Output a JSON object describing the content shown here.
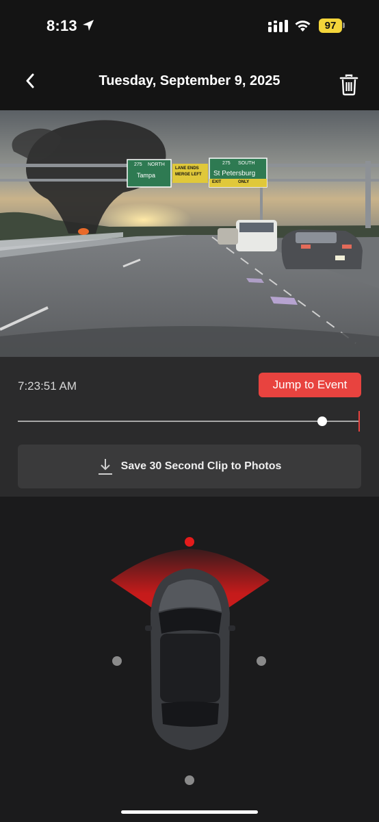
{
  "status_bar": {
    "time": "8:13",
    "battery": "97",
    "icons": [
      "location-arrow-icon",
      "cellular-signal-icon",
      "wifi-icon",
      "battery-icon"
    ]
  },
  "header": {
    "title": "Tuesday, September 9, 2025",
    "back_icon": "chevron-left-icon",
    "delete_icon": "trash-icon"
  },
  "video": {
    "signs": {
      "left_route": "275",
      "left_direction": "NORTH",
      "left_city": "Tampa",
      "middle_line1": "LANE ENDS",
      "middle_line2": "MERGE LEFT",
      "right_route": "275",
      "right_direction": "SOUTH",
      "right_city": "St Petersburg",
      "right_exit": "EXIT",
      "right_only": "ONLY"
    }
  },
  "playback": {
    "timestamp": "7:23:51 AM",
    "jump_label": "Jump to Event",
    "scrubber_position": 0.89,
    "save_label": "Save 30 Second Clip to Photos",
    "save_icon": "download-icon"
  },
  "cameras": {
    "active": "front",
    "items": [
      "front",
      "left",
      "right",
      "rear"
    ]
  },
  "colors": {
    "accent_red": "#e8433f",
    "battery_yellow": "#f4d53a",
    "background": "#1b1b1c",
    "panel": "#2b2b2c"
  }
}
